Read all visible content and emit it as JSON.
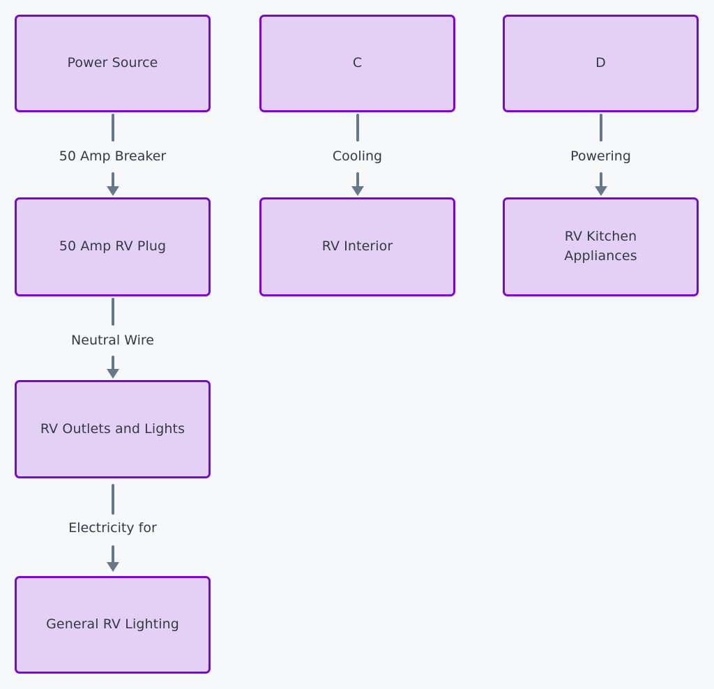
{
  "diagram": {
    "type": "flowchart",
    "direction": "top-to-bottom",
    "background_color": "#f7f8fa",
    "node_fill_color": "#e3d0f4",
    "node_border_color": "#7c06cf",
    "node_text_color": "#333a45",
    "edge_color": "#66788a",
    "nodes": [
      {
        "id": "power-source",
        "label": "Power Source",
        "column": 1,
        "row": 1
      },
      {
        "id": "c",
        "label": "C",
        "column": 2,
        "row": 1
      },
      {
        "id": "d",
        "label": "D",
        "column": 3,
        "row": 1
      },
      {
        "id": "50-amp-rv-plug",
        "label": "50 Amp RV Plug",
        "column": 1,
        "row": 2
      },
      {
        "id": "rv-interior",
        "label": "RV Interior",
        "column": 2,
        "row": 2
      },
      {
        "id": "rv-kitchen-appliances",
        "label": "RV Kitchen\nAppliances",
        "column": 3,
        "row": 2
      },
      {
        "id": "rv-outlets-and-lights",
        "label": "RV Outlets and Lights",
        "column": 1,
        "row": 3
      },
      {
        "id": "general-rv-lighting",
        "label": "General RV Lighting",
        "column": 1,
        "row": 4
      }
    ],
    "edges": [
      {
        "id": "edge-power-source-to-50-amp-rv-plug",
        "from": "power-source",
        "to": "50-amp-rv-plug",
        "label": "50 Amp Breaker"
      },
      {
        "id": "edge-c-to-rv-interior",
        "from": "c",
        "to": "rv-interior",
        "label": "Cooling"
      },
      {
        "id": "edge-d-to-rv-kitchen-appliances",
        "from": "d",
        "to": "rv-kitchen-appliances",
        "label": "Powering"
      },
      {
        "id": "edge-50-amp-rv-plug-to-rv-outlets-and-lights",
        "from": "50-amp-rv-plug",
        "to": "rv-outlets-and-lights",
        "label": "Neutral Wire"
      },
      {
        "id": "edge-rv-outlets-and-lights-to-general-rv-lighting",
        "from": "rv-outlets-and-lights",
        "to": "general-rv-lighting",
        "label": "Electricity for"
      }
    ]
  }
}
